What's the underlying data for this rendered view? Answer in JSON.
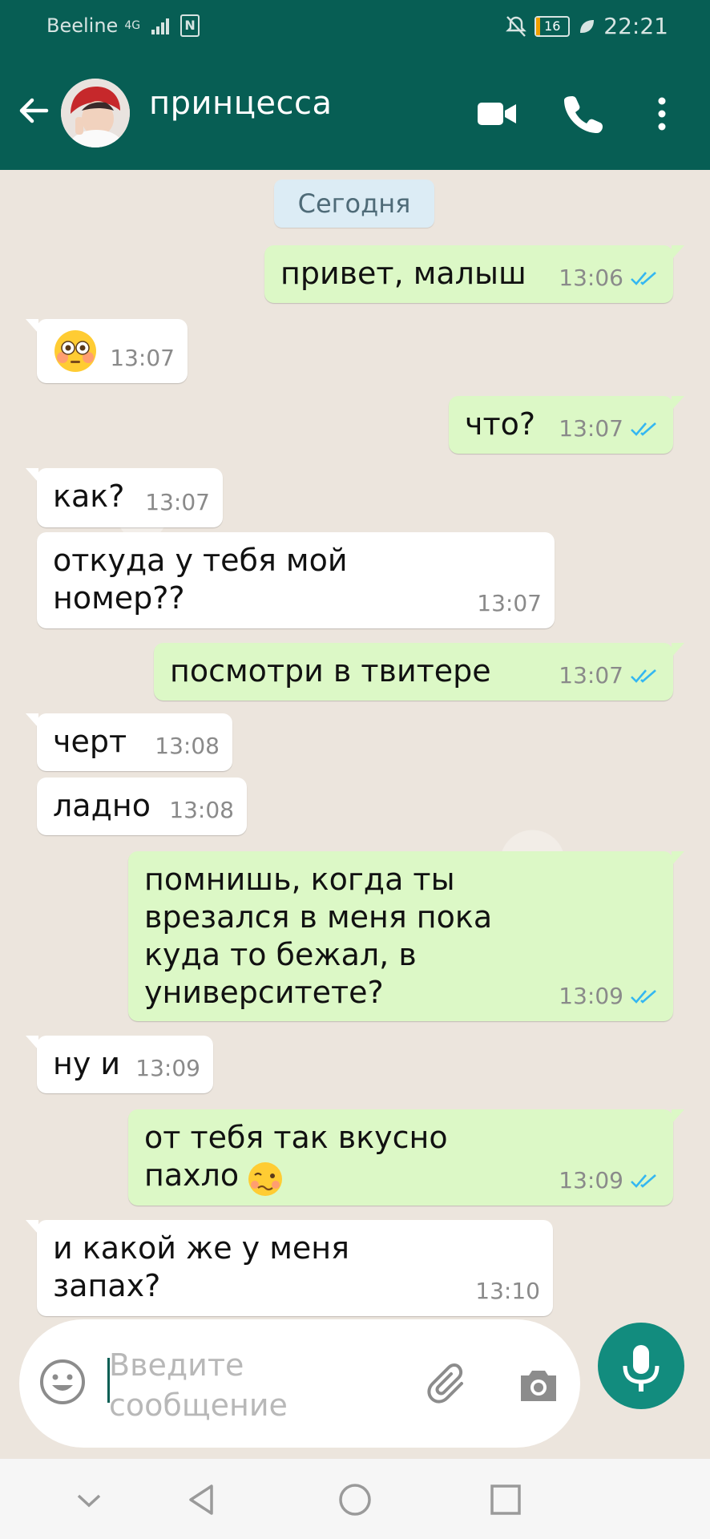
{
  "status_bar": {
    "carrier": "Beeline",
    "network": "4G",
    "battery": "16",
    "time": "22:21"
  },
  "header": {
    "contact_name": "принцесса"
  },
  "chat": {
    "date_label": "Сегодня",
    "messages": [
      {
        "text": "привет, малыш",
        "time": "13:06"
      },
      {
        "text": "",
        "time": "13:07"
      },
      {
        "text": "что?",
        "time": "13:07"
      },
      {
        "text": "как?",
        "time": "13:07"
      },
      {
        "text": "откуда у тебя мой\nномер??",
        "time": "13:07"
      },
      {
        "text": "посмотри в твитере",
        "time": "13:07"
      },
      {
        "text": "черт",
        "time": "13:08"
      },
      {
        "text": "ладно",
        "time": "13:08"
      },
      {
        "text": "помнишь, когда ты\nврезался в меня пока\nкуда то бежал, в\nуниверситете?",
        "time": "13:09"
      },
      {
        "text": "ну и",
        "time": "13:09"
      },
      {
        "text": "от тебя так вкусно\nпахло",
        "time": "13:09"
      },
      {
        "text": "и какой же у меня\nзапах?",
        "time": "13:10"
      }
    ]
  },
  "input": {
    "placeholder": "Введите сообщение"
  },
  "colors": {
    "header": "#075e54",
    "outgoing": "#dcf8c6",
    "incoming": "#ffffff",
    "read_ticks": "#34b7f1",
    "mic": "#128c7e"
  }
}
